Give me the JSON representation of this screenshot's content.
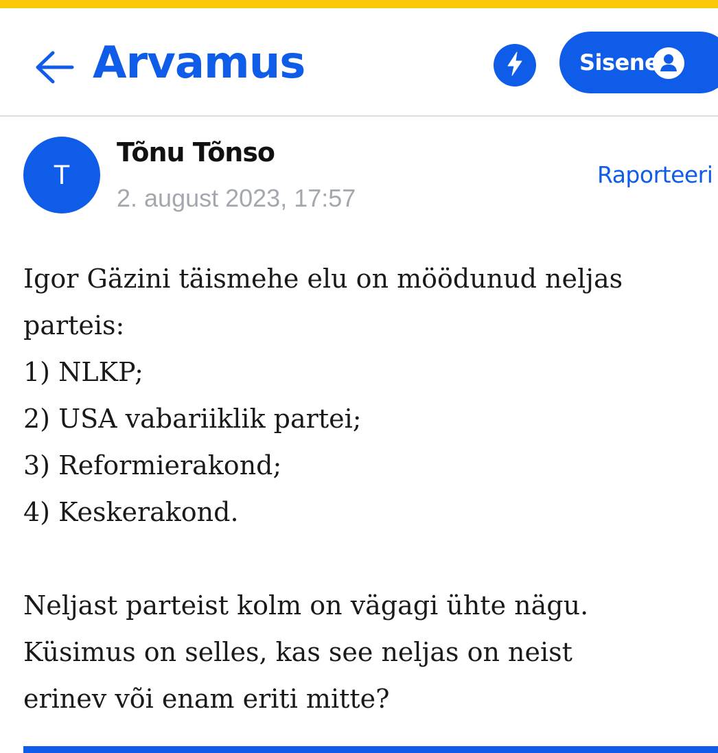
{
  "header": {
    "title": "Arvamus",
    "login_label": "Sisene",
    "icons": {
      "back": "arrow-left-icon",
      "flash": "lightning-bolt-icon",
      "user": "user-icon"
    },
    "accent_color": "#0f5ce8",
    "top_strip_color": "#f9c90a"
  },
  "comment": {
    "author_initial": "T",
    "author_name": "Tõnu Tõnso",
    "date": "2. august 2023, 17:57",
    "report_label": "Raporteeri",
    "lines": [
      "Igor Gäzini täismehe elu on möödunud neljas",
      "parteis:",
      "1) NLKP;",
      "2) USA vabariiklik partei;",
      "3) Reformierakond;",
      "4) Keskerakond.",
      "",
      "Neljast parteist kolm on vägagi ühte nägu.",
      "Küsimus on selles, kas see neljas on neist",
      "erinev või enam eriti mitte?"
    ]
  }
}
